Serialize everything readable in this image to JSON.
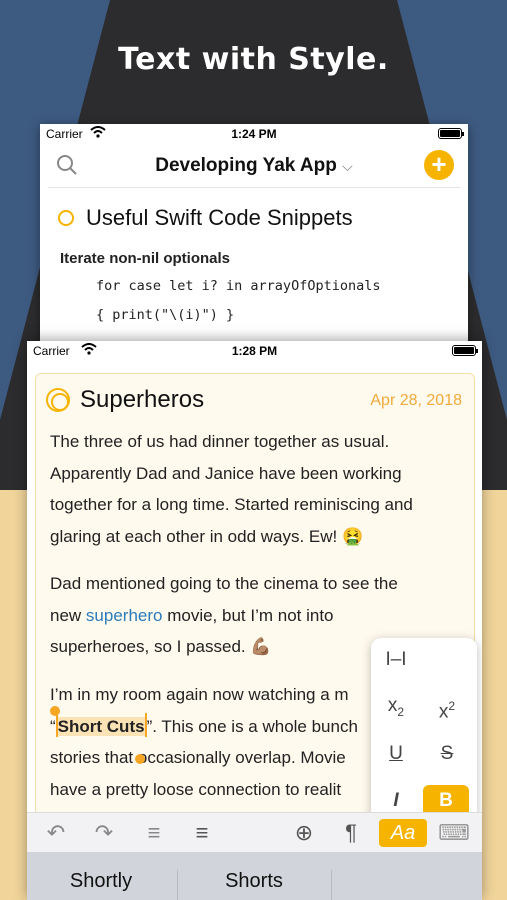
{
  "headline": "Text with Style.",
  "back_phone": {
    "status": {
      "carrier": "Carrier",
      "time": "1:24 PM"
    },
    "nav": {
      "title": "Developing Yak App",
      "chevron": "⌵",
      "add": "+"
    },
    "doc_title": "Useful Swift Code Snippets",
    "heading": "Iterate non-nil optionals",
    "code_lines": [
      "for case let i? in arrayOfOptionals",
      "{ print(\"\\(i)\") }"
    ]
  },
  "front_phone": {
    "status": {
      "carrier": "Carrier",
      "time": "1:28 PM"
    },
    "note": {
      "title": "Superheros",
      "date": "Apr 28, 2018",
      "p1": [
        "The three of us had dinner together as usual.",
        "Apparently Dad and Janice have been working",
        "together for a long time. Started reminiscing and",
        "glaring at each other in odd ways. Ew! 🤮"
      ],
      "p2_line1": "Dad mentioned going to the cinema to see the",
      "p2_line2_pre": "new ",
      "p2_link": "superhero",
      "p2_line2_post": " movie, but I’m not into",
      "p2_line3": "superheroes, so I passed. 💪🏽",
      "p3_line1": "I’m in my room again now watching a m",
      "p3_line2_open": "“",
      "p3_selected": "Short Cuts",
      "p3_line2_rest": "”. This one is a whole bunch",
      "p3_line3": "stories that occasionally overlap. Movie",
      "p3_line4": "have a pretty loose connection to realit"
    },
    "format_popover": {
      "mono": "I–I",
      "subscript_base": "x",
      "subscript": "2",
      "superscript_base": "x",
      "superscript": "2",
      "underline": "U",
      "strike": "S",
      "italic": "I",
      "bold": "B"
    },
    "toolbar": {
      "undo": "↶",
      "redo": "↷",
      "outdent": "≡",
      "indent": "≡",
      "add": "⊕",
      "pilcrow": "¶",
      "style": "Aa",
      "keyboard": "⌨"
    },
    "suggestions": [
      "Shortly",
      "Shorts"
    ]
  },
  "colors": {
    "accent": "#f6b400",
    "link": "#2b7bb9",
    "date": "#f2a93b"
  }
}
